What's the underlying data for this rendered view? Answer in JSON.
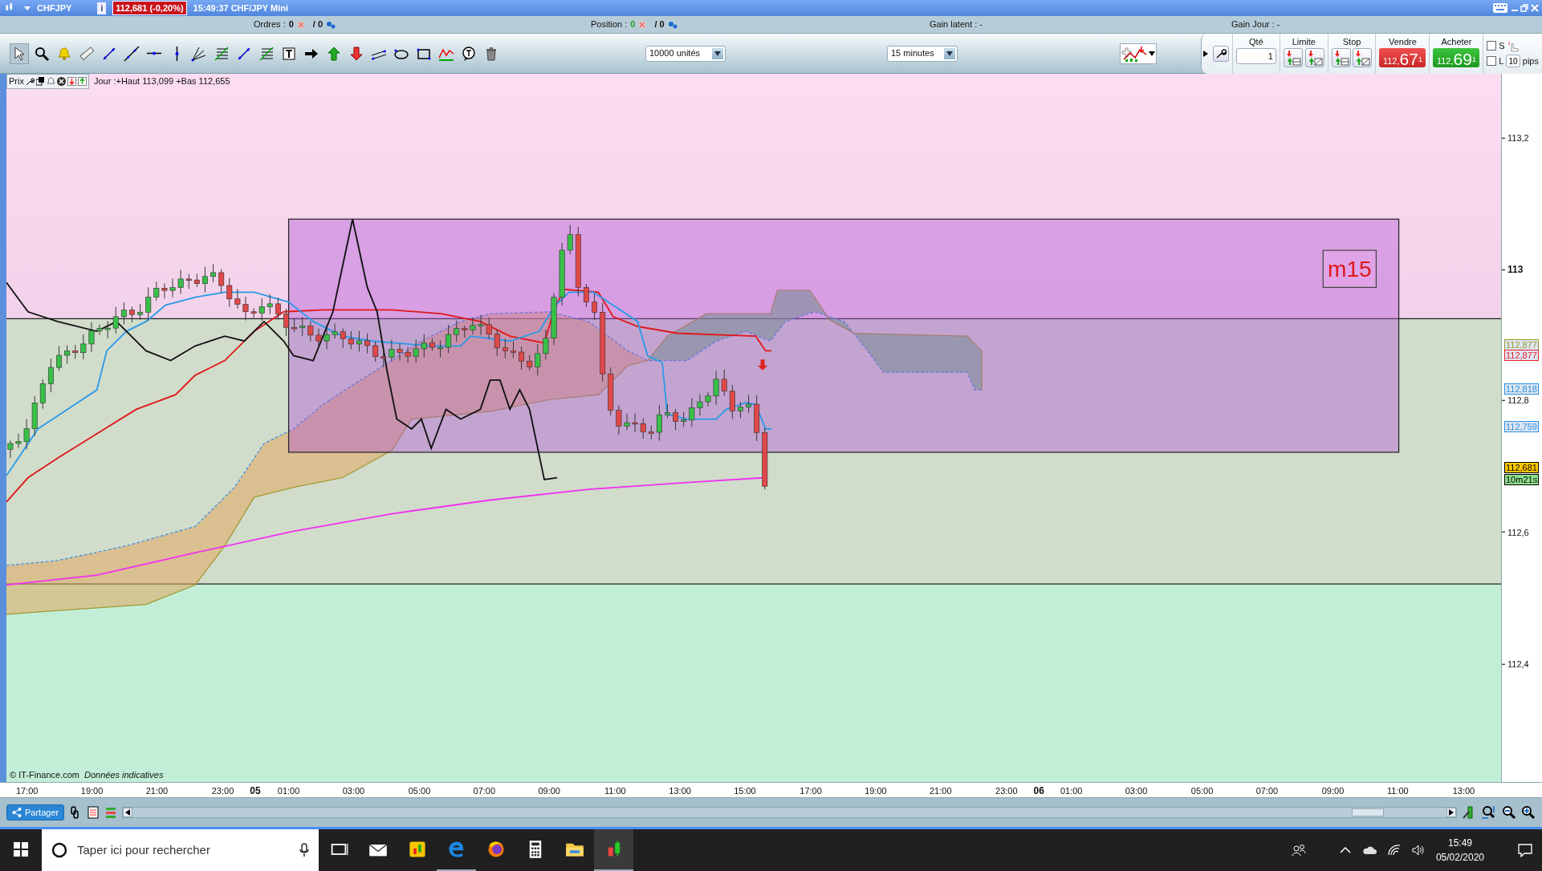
{
  "title_bar": {
    "symbol": "CHFJPY",
    "info": "i",
    "price_change": "112,681 (-0,20%)",
    "caption": "15:49:37 CHF/JPY Mini"
  },
  "info_bar": {
    "orders_label": "Ordres :",
    "orders_count": "0",
    "orders_total": "/ 0",
    "position_label": "Position :",
    "position_count": "0",
    "position_total": "/ 0",
    "gain_latent": "Gain latent : -",
    "gain_jour": "Gain Jour : -"
  },
  "tools": [
    {
      "kind": "pointer",
      "selected": true
    },
    {
      "kind": "magnifier",
      "selected": false
    },
    {
      "kind": "bell",
      "selected": false
    },
    {
      "kind": "ruler",
      "selected": false
    },
    {
      "kind": "segment",
      "selected": false
    },
    {
      "kind": "line",
      "selected": false
    },
    {
      "kind": "hline",
      "selected": false
    },
    {
      "kind": "vline",
      "selected": false
    },
    {
      "kind": "fan",
      "selected": false
    },
    {
      "kind": "grid",
      "selected": false
    },
    {
      "kind": "segment",
      "selected": false
    },
    {
      "kind": "grid",
      "selected": false
    },
    {
      "kind": "text",
      "selected": false
    },
    {
      "kind": "arrow-right",
      "selected": false
    },
    {
      "kind": "arrow-up",
      "selected": false
    },
    {
      "kind": "arrow-down",
      "selected": false
    },
    {
      "kind": "channel",
      "selected": false
    },
    {
      "kind": "ellipse",
      "selected": false
    },
    {
      "kind": "rectangle",
      "selected": false
    },
    {
      "kind": "indicator",
      "selected": false
    },
    {
      "kind": "bubble",
      "selected": false
    },
    {
      "kind": "trash",
      "selected": false
    }
  ],
  "quantity_select": {
    "value": "10000 unités"
  },
  "period_select": {
    "value": "15 minutes"
  },
  "order_panel": {
    "qty_label": "Qté",
    "qty_value": "1",
    "limit_label": "Limite",
    "stop_label": "Stop",
    "sell": {
      "label": "Vendre",
      "prefix": "112,",
      "main": "67",
      "pip": "1"
    },
    "buy": {
      "label": "Acheter",
      "prefix": "112,",
      "main": "69",
      "pip": "1"
    },
    "options": [
      {
        "label": "S",
        "checked": false
      },
      {
        "label": "L",
        "checked": false
      }
    ],
    "pips_value": "10",
    "pips_label": "pips"
  },
  "chart": {
    "header_label": "Prix",
    "header_info": "Jour :+Haut 113,099 +Bas 112,655",
    "zone_label": "m15",
    "copyright": "© IT-Finance.com",
    "disclaimer": "Données indicatives",
    "y_labels": [
      {
        "text": "113,2",
        "bold": false
      },
      {
        "text": "113",
        "bold": true
      },
      {
        "text": "112,8",
        "bold": false
      },
      {
        "text": "112,6",
        "bold": false
      },
      {
        "text": "112,4",
        "bold": false
      }
    ],
    "price_tags": [
      {
        "text": "112,877",
        "color": "#9a9a28",
        "kind": "indicator"
      },
      {
        "text": "112,877",
        "color": "#e8202a",
        "kind": "indicator"
      },
      {
        "text": "112,818",
        "color": "#2a90e0",
        "kind": "indicator"
      },
      {
        "text": "112,759",
        "color": "#2a90e0",
        "kind": "indicator"
      },
      {
        "text": "112,681",
        "color": "#000000",
        "kind": "last-price"
      },
      {
        "text": "10m21s",
        "color": "#000000",
        "kind": "countdown"
      }
    ],
    "x_labels": [
      {
        "text": "17:00",
        "kind": "time"
      },
      {
        "text": "19:00",
        "kind": "time"
      },
      {
        "text": "21:00",
        "kind": "time"
      },
      {
        "text": "23:00",
        "kind": "time"
      },
      {
        "text": "05",
        "kind": "day"
      },
      {
        "text": "01:00",
        "kind": "time"
      },
      {
        "text": "03:00",
        "kind": "time"
      },
      {
        "text": "05:00",
        "kind": "time"
      },
      {
        "text": "07:00",
        "kind": "time"
      },
      {
        "text": "09:00",
        "kind": "time"
      },
      {
        "text": "11:00",
        "kind": "time"
      },
      {
        "text": "13:00",
        "kind": "time"
      },
      {
        "text": "15:00",
        "kind": "time"
      },
      {
        "text": "17:00",
        "kind": "time"
      },
      {
        "text": "19:00",
        "kind": "time"
      },
      {
        "text": "21:00",
        "kind": "time"
      },
      {
        "text": "23:00",
        "kind": "time"
      },
      {
        "text": "06",
        "kind": "day"
      },
      {
        "text": "01:00",
        "kind": "time"
      },
      {
        "text": "03:00",
        "kind": "time"
      },
      {
        "text": "05:00",
        "kind": "time"
      },
      {
        "text": "07:00",
        "kind": "time"
      },
      {
        "text": "09:00",
        "kind": "time"
      },
      {
        "text": "11:00",
        "kind": "time"
      },
      {
        "text": "13:00",
        "kind": "time"
      }
    ]
  },
  "bottom_bar": {
    "share_button": "Partager"
  },
  "taskbar": {
    "search_placeholder": "Taper ici pour rechercher",
    "apps": [
      {
        "kind": "taskview",
        "running": false,
        "active": false
      },
      {
        "kind": "mail",
        "running": false,
        "active": false
      },
      {
        "kind": "chart-app",
        "running": false,
        "active": false
      },
      {
        "kind": "edge",
        "running": true,
        "active": false
      },
      {
        "kind": "firefox",
        "running": false,
        "active": false
      },
      {
        "kind": "calculator",
        "running": false,
        "active": false
      },
      {
        "kind": "folder",
        "running": false,
        "active": false
      },
      {
        "kind": "trading",
        "running": true,
        "active": true
      }
    ],
    "time": "15:49",
    "date": "05/02/2020"
  }
}
